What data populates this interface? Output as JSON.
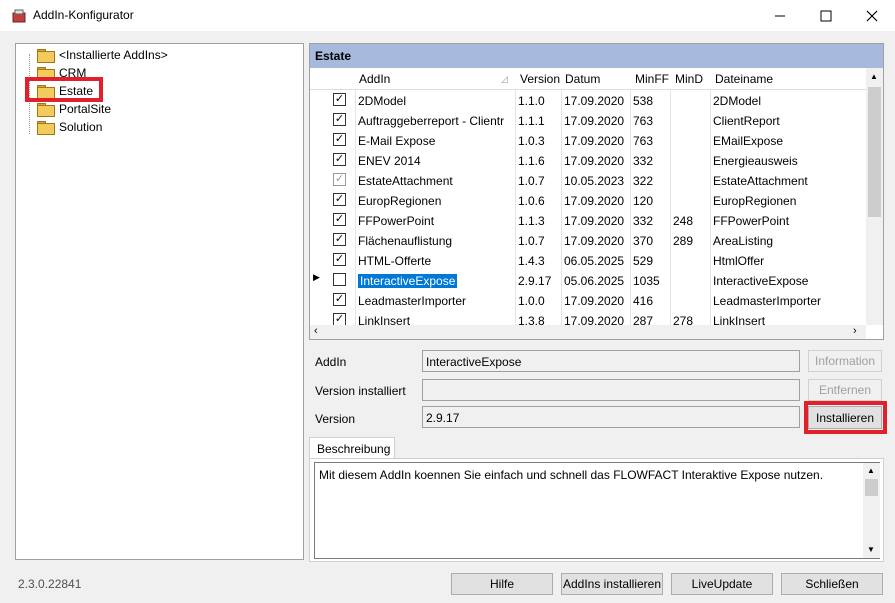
{
  "window": {
    "title": "AddIn-Konfigurator"
  },
  "tree": {
    "items": [
      {
        "label": "<Installierte AddIns>"
      },
      {
        "label": "CRM"
      },
      {
        "label": "Estate"
      },
      {
        "label": "PortalSite"
      },
      {
        "label": "Solution"
      }
    ],
    "selected": "Estate"
  },
  "grid": {
    "caption": "Estate",
    "columns": [
      "AddIn",
      "Version",
      "Datum",
      "MinFF",
      "MinD",
      "Dateiname"
    ],
    "rows": [
      {
        "checked": true,
        "addin": "2DModel",
        "version": "1.1.0",
        "datum": "17.09.2020",
        "minff": "538",
        "mind": "",
        "datei": "2DModel"
      },
      {
        "checked": true,
        "addin": "Auftraggeberreport - Clientr",
        "version": "1.1.1",
        "datum": "17.09.2020",
        "minff": "763",
        "mind": "",
        "datei": "ClientReport"
      },
      {
        "checked": true,
        "addin": "E-Mail Expose",
        "version": "1.0.3",
        "datum": "17.09.2020",
        "minff": "763",
        "mind": "",
        "datei": "EMailExpose"
      },
      {
        "checked": true,
        "addin": "ENEV 2014",
        "version": "1.1.6",
        "datum": "17.09.2020",
        "minff": "332",
        "mind": "",
        "datei": "Energieausweis"
      },
      {
        "checked": true,
        "disabled": true,
        "addin": "EstateAttachment",
        "version": "1.0.7",
        "datum": "10.05.2023",
        "minff": "322",
        "mind": "",
        "datei": "EstateAttachment"
      },
      {
        "checked": true,
        "addin": "EuropRegionen",
        "version": "1.0.6",
        "datum": "17.09.2020",
        "minff": "120",
        "mind": "",
        "datei": "EuropRegionen"
      },
      {
        "checked": true,
        "addin": "FFPowerPoint",
        "version": "1.1.3",
        "datum": "17.09.2020",
        "minff": "332",
        "mind": "248",
        "datei": "FFPowerPoint"
      },
      {
        "checked": true,
        "addin": "Flächenauflistung",
        "version": "1.0.7",
        "datum": "17.09.2020",
        "minff": "370",
        "mind": "289",
        "datei": "AreaListing"
      },
      {
        "checked": true,
        "addin": "HTML-Offerte",
        "version": "1.4.3",
        "datum": "06.05.2025",
        "minff": "529",
        "mind": "",
        "datei": "HtmlOffer"
      },
      {
        "checked": false,
        "current": true,
        "addin": "InteractiveExpose",
        "version": "2.9.17",
        "datum": "05.06.2025",
        "minff": "1035",
        "mind": "",
        "datei": "InteractiveExpose"
      },
      {
        "checked": true,
        "addin": "LeadmasterImporter",
        "version": "1.0.0",
        "datum": "17.09.2020",
        "minff": "416",
        "mind": "",
        "datei": "LeadmasterImporter"
      },
      {
        "checked": true,
        "addin": "LinkInsert",
        "version": "1.3.8",
        "datum": "17.09.2020",
        "minff": "287",
        "mind": "278",
        "datei": "LinkInsert"
      }
    ]
  },
  "form": {
    "addin_label": "AddIn",
    "addin_value": "InteractiveExpose",
    "version_installed_label": "Version installiert",
    "version_installed_value": "",
    "version_label": "Version",
    "version_value": "2.9.17",
    "information_button": "Information",
    "remove_button": "Entfernen",
    "install_button": "Installieren"
  },
  "description": {
    "tab_label": "Beschreibung",
    "text": "Mit diesem AddIn koennen Sie einfach und schnell das FLOWFACT Interaktive Expose nutzen."
  },
  "footer": {
    "version": "2.3.0.22841",
    "help_button": "Hilfe",
    "install_addins_button": "AddIns installieren",
    "liveupdate_button": "LiveUpdate",
    "close_button": "Schließen"
  },
  "colors": {
    "highlight_box": "#e0202a",
    "caption_bg": "#a7b9dd",
    "selection": "#0078d7"
  },
  "icons": [
    "app-icon",
    "minimize-icon",
    "maximize-icon",
    "close-icon",
    "folder-icon",
    "row-pointer-icon",
    "scroll-left-icon",
    "scroll-right-icon",
    "scroll-up-icon",
    "scroll-down-icon"
  ]
}
